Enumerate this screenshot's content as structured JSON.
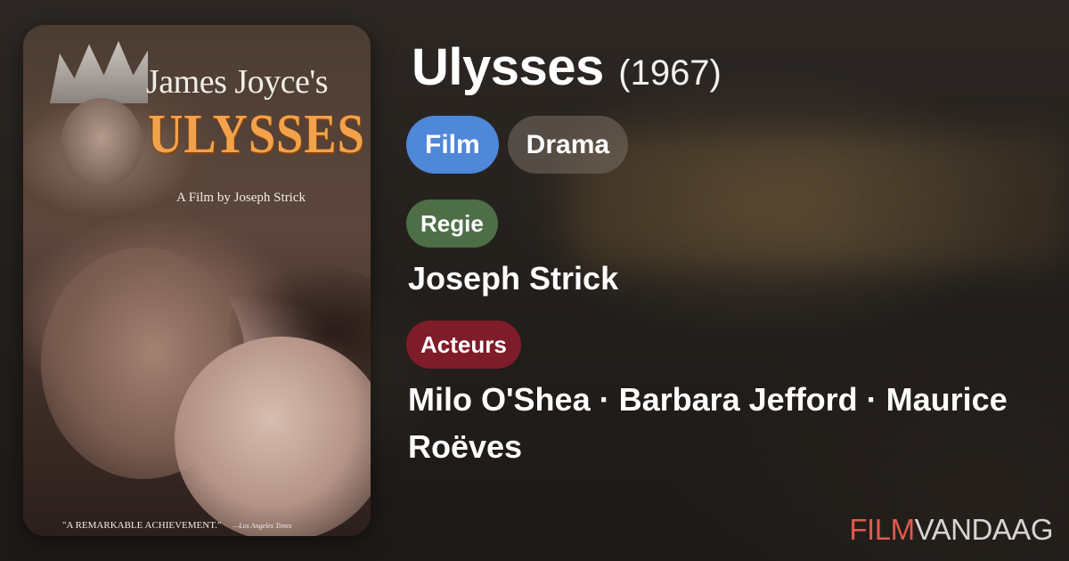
{
  "movie": {
    "title": "Ulysses",
    "year": "(1967)",
    "genres": [
      "Film",
      "Drama"
    ],
    "director_label": "Regie",
    "director": "Joseph Strick",
    "cast_label": "Acteurs",
    "cast": "Milo O'Shea · Barbara Jefford · Maurice Roëves"
  },
  "poster": {
    "line1": "James Joyce's",
    "title": "ULYSSES",
    "subtitle": "A Film by Joseph Strick",
    "quote": "\"A REMARKABLE ACHIEVEMENT.\"",
    "quote_source": "—Los Angeles Times"
  },
  "brand": {
    "part1": "FILM",
    "part2": "VANDAAG"
  },
  "colors": {
    "genre_primary": "#4f87d9",
    "genre_secondary": "#6e655d",
    "regie_label": "#4e6e48",
    "acteurs_label": "#7f1c2a",
    "brand_accent": "#e05a4f"
  }
}
